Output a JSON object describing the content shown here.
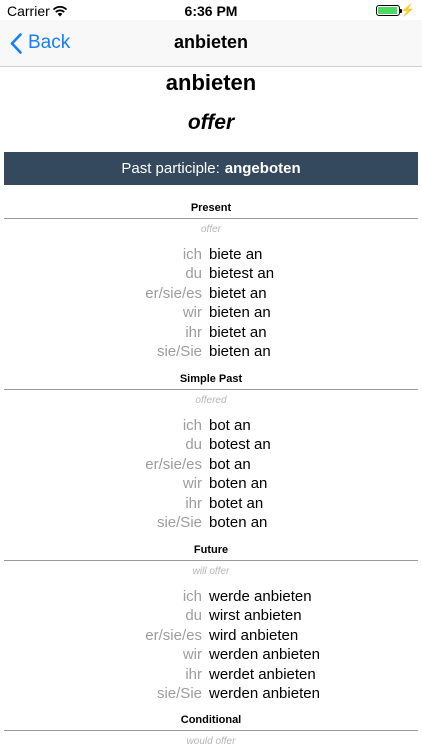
{
  "status": {
    "carrier": "Carrier",
    "time": "6:36 PM"
  },
  "nav": {
    "back_label": "Back",
    "title": "anbieten"
  },
  "word": {
    "infinitive": "anbieten",
    "translation": "offer"
  },
  "past_participle": {
    "label": "Past participle:",
    "value": "angeboten"
  },
  "sections": [
    {
      "title": "Present",
      "translation": "offer",
      "rows": [
        {
          "pronoun": "ich",
          "form": "biete an"
        },
        {
          "pronoun": "du",
          "form": "bietest an"
        },
        {
          "pronoun": "er/sie/es",
          "form": "bietet an"
        },
        {
          "pronoun": "wir",
          "form": "bieten an"
        },
        {
          "pronoun": "ihr",
          "form": "bietet an"
        },
        {
          "pronoun": "sie/Sie",
          "form": "bieten an"
        }
      ]
    },
    {
      "title": "Simple Past",
      "translation": "offered",
      "rows": [
        {
          "pronoun": "ich",
          "form": "bot an"
        },
        {
          "pronoun": "du",
          "form": "botest an"
        },
        {
          "pronoun": "er/sie/es",
          "form": "bot an"
        },
        {
          "pronoun": "wir",
          "form": "boten an"
        },
        {
          "pronoun": "ihr",
          "form": "botet an"
        },
        {
          "pronoun": "sie/Sie",
          "form": "boten an"
        }
      ]
    },
    {
      "title": "Future",
      "translation": "will offer",
      "rows": [
        {
          "pronoun": "ich",
          "form": "werde anbieten"
        },
        {
          "pronoun": "du",
          "form": "wirst anbieten"
        },
        {
          "pronoun": "er/sie/es",
          "form": "wird anbieten"
        },
        {
          "pronoun": "wir",
          "form": "werden anbieten"
        },
        {
          "pronoun": "ihr",
          "form": "werdet anbieten"
        },
        {
          "pronoun": "sie/Sie",
          "form": "werden anbieten"
        }
      ]
    },
    {
      "title": "Conditional",
      "translation": "would offer",
      "rows": []
    }
  ],
  "colors": {
    "accent": "#147efb",
    "banner": "#34495e",
    "battery": "#4cd964"
  }
}
